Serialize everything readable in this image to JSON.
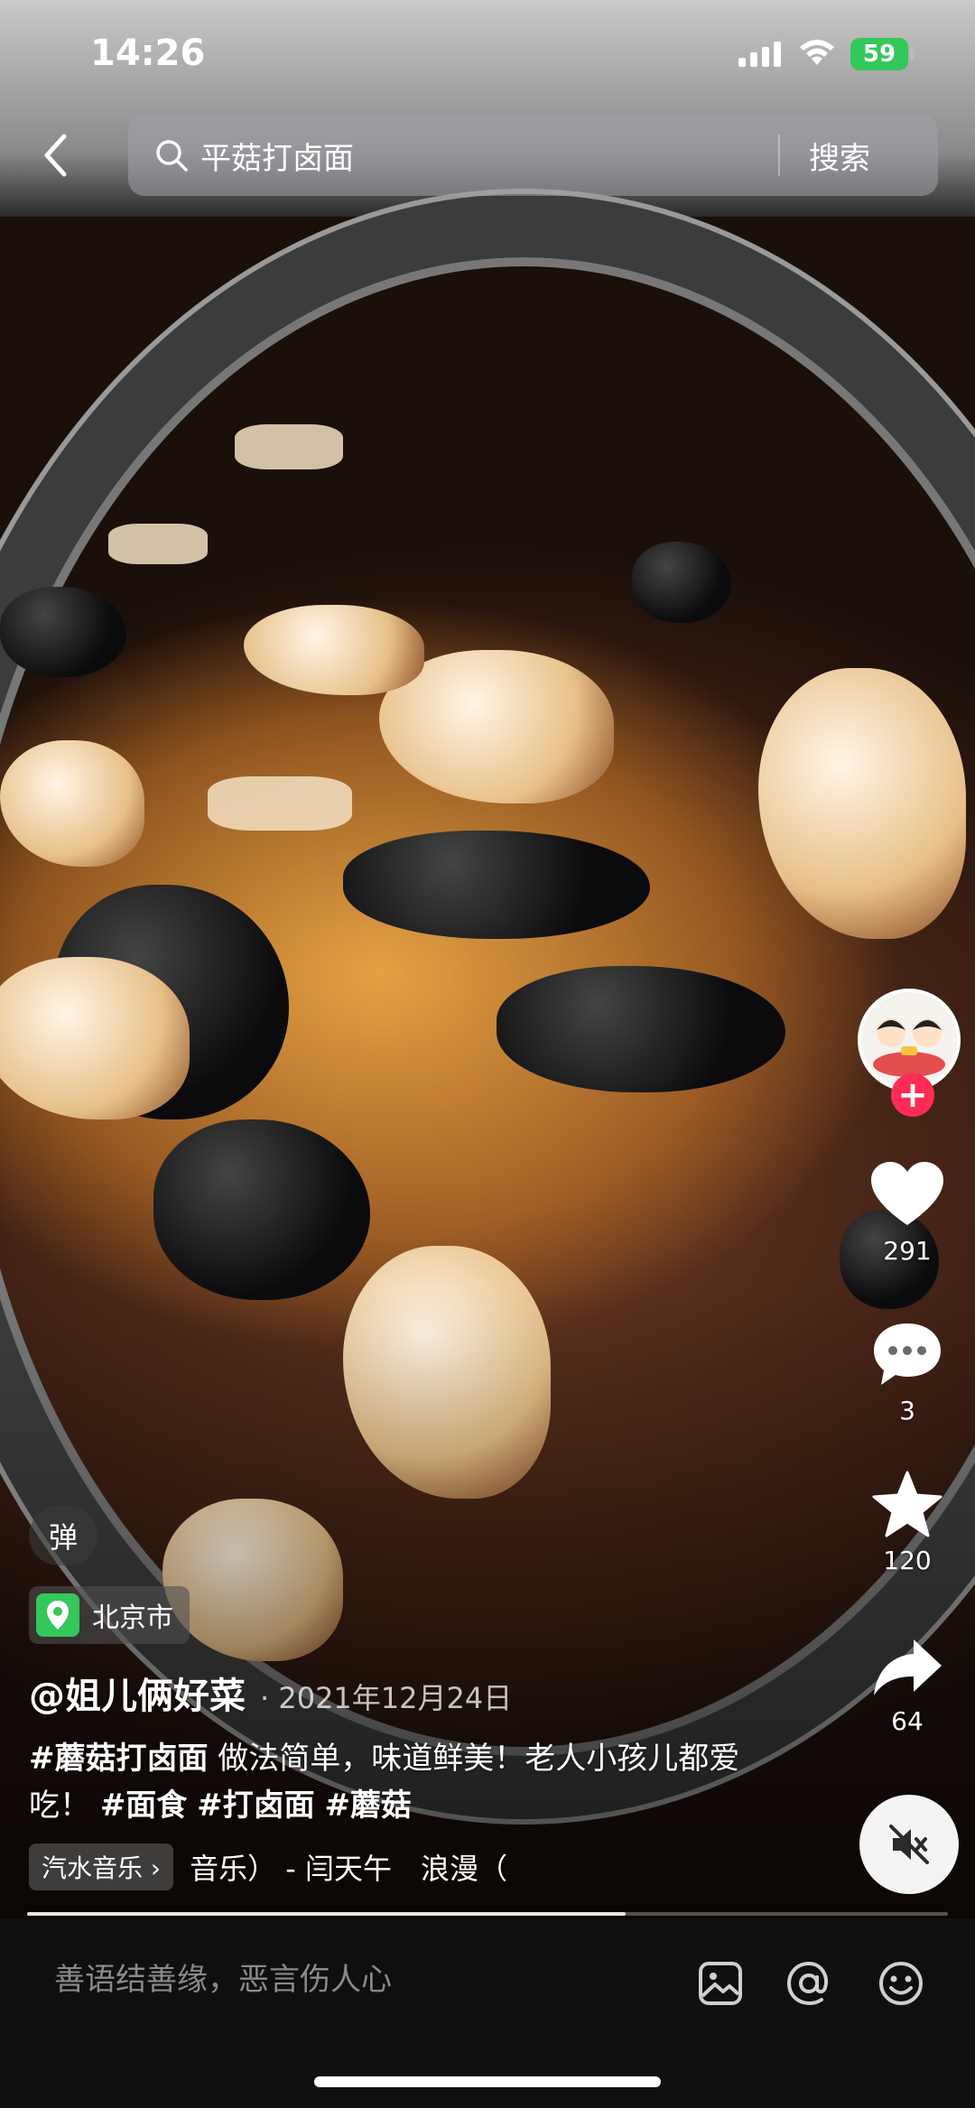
{
  "status_bar": {
    "time": "14:26",
    "battery": "59"
  },
  "search": {
    "query": "平菇打卤面",
    "button_label": "搜索"
  },
  "actions": {
    "likes": "291",
    "comments": "3",
    "favorites": "120",
    "shares": "64",
    "follow_symbol": "+"
  },
  "post": {
    "danmu_label": "弹",
    "location": "北京市",
    "author": "@姐儿俩好菜",
    "date": "· 2021年12月24日",
    "caption": {
      "tag1": "#蘑菇打卤面",
      "text": " 做法简单，味道鲜美！老人小孩儿都爱吃！ ",
      "tag2": "#面食",
      "tag3": "#打卤面",
      "tag4": "#蘑菇"
    },
    "music_chip": "汽水音乐 ›",
    "music_text": "音乐） - 闫天午　浪漫（"
  },
  "progress": {
    "fraction": 0.65
  },
  "comment_bar": {
    "placeholder": "善语结善缘，恶言伤人心"
  },
  "icons": {
    "back": "chevron-left-icon",
    "search": "search-icon",
    "like": "heart-icon",
    "comment": "comment-bubble-icon",
    "favorite": "star-icon",
    "share": "share-arrow-icon",
    "mute": "speaker-muted-icon",
    "image": "image-icon",
    "mention": "at-icon",
    "emoji": "emoji-icon",
    "location": "location-pin-icon"
  },
  "colors": {
    "accent": "#fe2c55",
    "battery": "#34c759",
    "location": "#34c759"
  }
}
